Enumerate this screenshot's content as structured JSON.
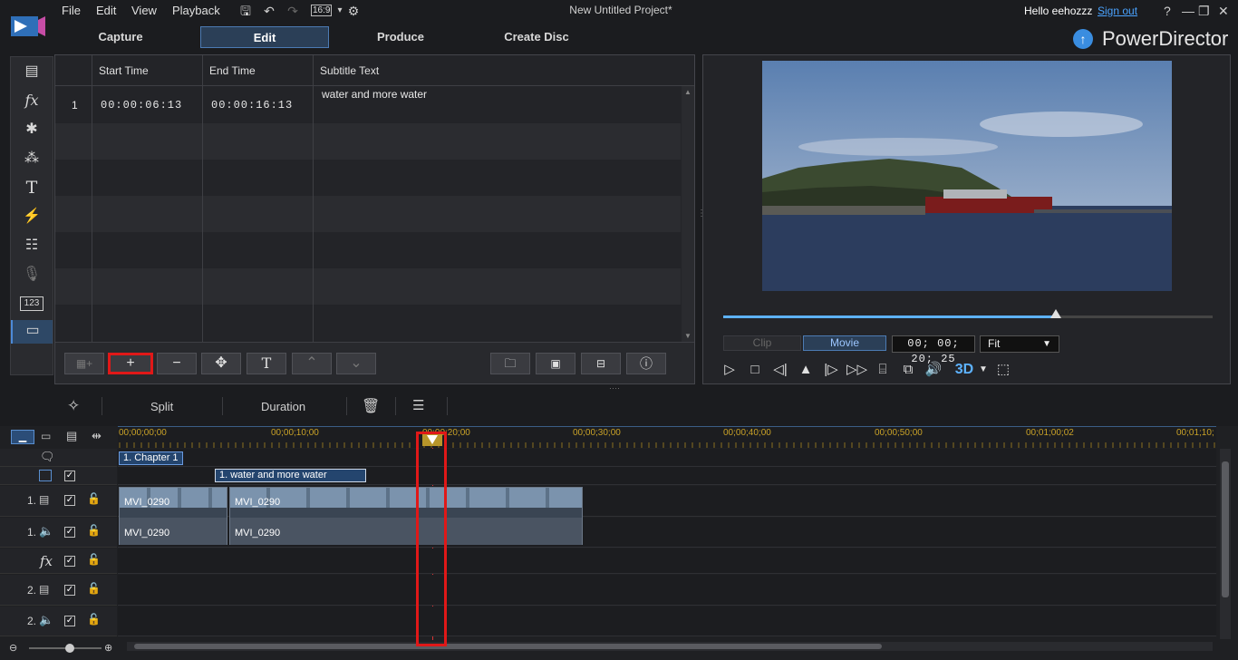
{
  "menu": [
    "File",
    "Edit",
    "View",
    "Playback"
  ],
  "aspect_ratio": "16:9",
  "project_title": "New Untitled Project*",
  "user": {
    "greeting": "Hello eehozzz",
    "signout": "Sign out"
  },
  "window_controls": [
    "?",
    "—",
    "❐",
    "✕"
  ],
  "tabs": [
    {
      "label": "Capture"
    },
    {
      "label": "Edit",
      "active": true
    },
    {
      "label": "Produce"
    },
    {
      "label": "Create Disc"
    }
  ],
  "brand": "PowerDirector",
  "left_tools": [
    "media-room-icon",
    "fx-room-icon",
    "pip-room-icon",
    "particle-room-icon",
    "title-room-icon",
    "transition-room-icon",
    "audio-mixing-icon",
    "voice-over-icon",
    "chapter-room-icon",
    "subtitle-room-icon"
  ],
  "subtitle_table": {
    "headers": [
      "Start Time",
      "End Time",
      "Subtitle Text"
    ],
    "rows": [
      {
        "index": "1",
        "start": "00:00:06:13",
        "end": "00:00:16:13",
        "text": "water and more water"
      }
    ]
  },
  "subtitle_buttons": [
    "import-subtitle",
    "add",
    "remove",
    "merge",
    "text-format",
    "move-up",
    "move-down",
    "import-file",
    "export-file",
    "sync",
    "info"
  ],
  "preview": {
    "progress": 0.68,
    "mode_clip": "Clip",
    "mode_movie": "Movie",
    "timecode": "00; 00; 20; 25",
    "fit": "Fit",
    "mode_3d": "3D"
  },
  "edit_toolbar": {
    "split": "Split",
    "duration": "Duration"
  },
  "ruler_labels": [
    "00;00;00;00",
    "00;00;10;00",
    "00;00;20;00",
    "00;00;30;00",
    "00;00;40;00",
    "00;00;50;00",
    "00;01;00;02",
    "00;01;10;"
  ],
  "timeline": {
    "chapter": "1. Chapter 1",
    "subtitle_clip": "1. water and more water",
    "clip_names": [
      "MVI_0290",
      "MVI_0290",
      "MVI_0290",
      "MVI_0290"
    ],
    "track_labels": [
      "1.",
      "1.",
      "2.",
      "2."
    ]
  }
}
